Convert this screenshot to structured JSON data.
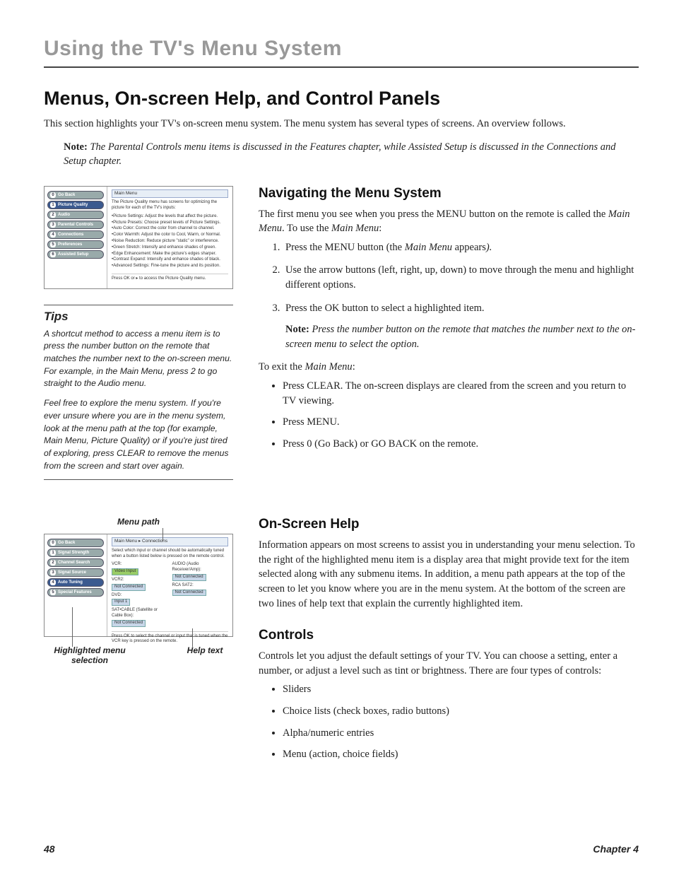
{
  "chapter_title": "Using the TV's Menu System",
  "section_title": "Menus, On-screen Help, and Control Panels",
  "intro": "This section highlights your TV's on-screen menu system. The menu system has several types of screens. An overview follows.",
  "note1_label": "Note:",
  "note1": " The Parental Controls menu items is discussed in the Features chapter, while Assisted Setup is discussed in the Connections and Setup chapter.",
  "nav": {
    "heading": "Navigating the Menu System",
    "intro_a": "The first menu you see when you press the MENU button on the remote is called the ",
    "intro_em1": "Main Menu",
    "intro_mid": ". To use the ",
    "intro_em2": "Main Menu",
    "intro_end": ":",
    "steps": {
      "s1_a": "Press the MENU button (the ",
      "s1_em": "Main Menu",
      "s1_b": " appears",
      "s1_c": ").",
      "s2": "Use the arrow buttons (left, right, up, down) to move through the menu and highlight different options.",
      "s3": "Press the OK button to select a highlighted item.",
      "s3_note_label": "Note:",
      "s3_note": " Press the number button on the remote that matches the number next to the on-screen menu to select the option."
    },
    "exit_a": "To exit the ",
    "exit_em": "Main Menu",
    "exit_b": ":",
    "exits": {
      "e1": "Press CLEAR. The on-screen displays are cleared from the screen and you return to TV viewing.",
      "e2": "Press MENU.",
      "e3": "Press 0 (Go Back) or GO BACK on the remote."
    }
  },
  "tips": {
    "heading": "Tips",
    "p1": "A shortcut method to access a menu item is to press the number button on the remote that matches the number next to the on-screen menu. For example, in the Main Menu, press 2 to go straight to the Audio menu.",
    "p2": "Feel free to explore the menu system. If you're ever unsure where you are in the menu system,  look at the menu path at the top (for example, Main Menu, Picture Quality) or if you're just  tired of exploring, press CLEAR to remove the menus from the screen and start over again."
  },
  "screenshot1": {
    "title": "Main Menu",
    "intro": "The Picture Quality menu has screens for optimizing the picture for each of the TV's inputs:",
    "buttons": [
      "Go Back",
      "Picture Quality",
      "Audio",
      "Parental Controls",
      "Connections",
      "Preferences",
      "Assisted Setup"
    ],
    "lines": [
      "•Picture Settings: Adjust the levels that affect the picture.",
      "•Picture Presets: Choose preset levels of Picture Settings.",
      "•Auto Color: Correct the color from channel to channel.",
      "•Color Warmth: Adjust the color to Cool, Warm, or Normal.",
      "•Noise Reduction: Reduce picture \"static\" or interference.",
      "•Green Stretch: Intensify and enhance shades of green.",
      "•Edge Enhancement: Make the picture's edges sharper.",
      "•Contrast Expand: Intensify and enhance shades of black.",
      "•Advanced Settings: Fine-tune the picture and its position."
    ],
    "foot": "Press OK or ▸ to access the Picture Quality menu."
  },
  "screenshot2": {
    "title": "Main Menu ▸ Connections",
    "intro": "Select which input or channel should be automatically tuned when a button listed below is pressed on the remote control.",
    "buttons": [
      "Go Back",
      "Signal Strength",
      "Channel Search",
      "Signal Source",
      "Auto Tuning",
      "Special Features"
    ],
    "rows": {
      "r1a": "VCR:",
      "r1b": "AUDIO (Audio Receiver/Amp):",
      "t1a": "Video Input",
      "t1b": "Not Connected",
      "r2a": "VCR2:",
      "r2b": "RCA SAT2:",
      "t2a": "Not Connected",
      "t2b": "Not Connected",
      "r3a": "DVD:",
      "t3a": "Input 1",
      "r4a": "SAT•CABLE (Satellite or Cable Box):",
      "t4a": "Not Connected"
    },
    "foot": "Press OK to select the channel or input that is tuned when the VCR key is pressed on the remote."
  },
  "callouts": {
    "menu_path": "Menu path",
    "highlight": "Highlighted menu selection",
    "help_text": "Help text"
  },
  "help": {
    "heading": "On-Screen Help",
    "body": "Information appears on most screens to assist you in understanding your menu selection. To the right of the highlighted menu item is a display area that might provide text for the item selected along with any submenu items. In addition, a menu path appears at the top of the screen to let you know where you are in the menu system. At the bottom of the screen are two lines of help text that explain the currently highlighted item."
  },
  "controls": {
    "heading": "Controls",
    "body": "Controls let you adjust the default settings of your TV. You can choose a setting, enter a number, or adjust a level such as tint or brightness. There are four types of controls:",
    "items": [
      "Sliders",
      "Choice lists (check boxes, radio buttons)",
      "Alpha/numeric entries",
      "Menu (action, choice fields)"
    ]
  },
  "footer": {
    "page": "48",
    "chapter": "Chapter 4"
  }
}
